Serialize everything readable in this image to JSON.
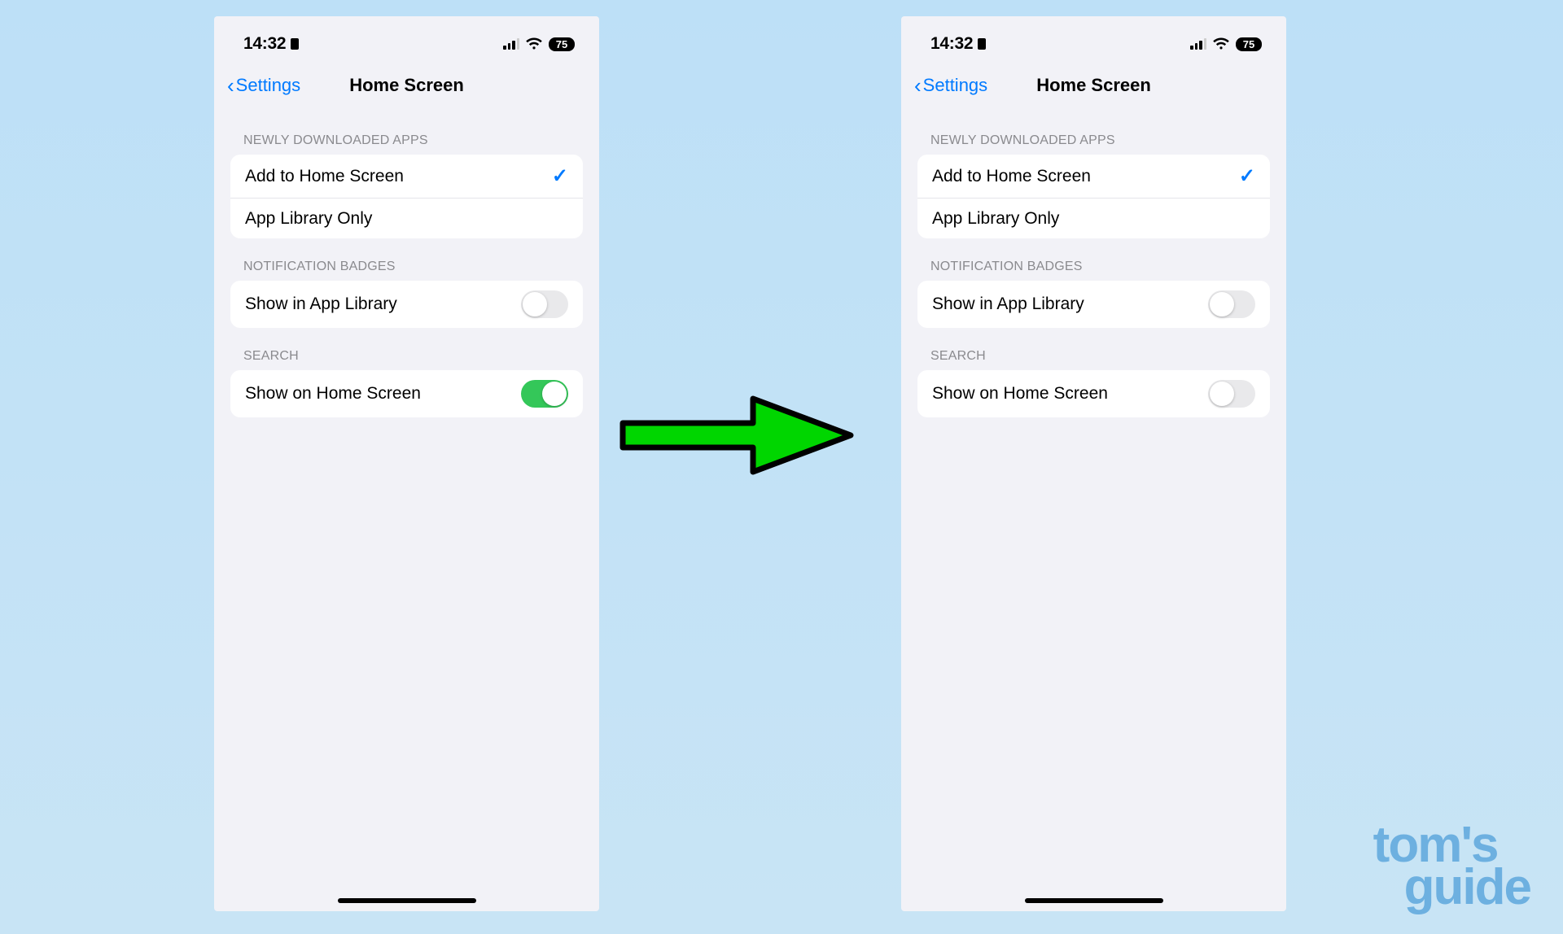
{
  "statusbar": {
    "time": "14:32",
    "battery": "75"
  },
  "nav": {
    "back_label": "Settings",
    "title": "Home Screen"
  },
  "sections": {
    "newly_downloaded": {
      "header": "NEWLY DOWNLOADED APPS",
      "rows": [
        {
          "label": "Add to Home Screen",
          "checked": true
        },
        {
          "label": "App Library Only",
          "checked": false
        }
      ]
    },
    "notification_badges": {
      "header": "NOTIFICATION BADGES",
      "rows": [
        {
          "label": "Show in App Library",
          "toggle_left": false,
          "toggle_right": false
        }
      ]
    },
    "search": {
      "header": "SEARCH",
      "rows": [
        {
          "label": "Show on Home Screen",
          "toggle_left": true,
          "toggle_right": false
        }
      ]
    }
  },
  "watermark": {
    "line1": "tom's",
    "line2": "guide"
  }
}
